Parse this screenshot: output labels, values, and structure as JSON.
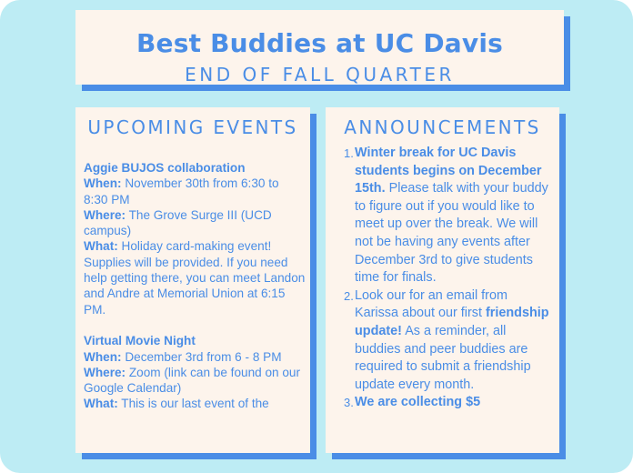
{
  "header": {
    "title": "Best Buddies at UC Davis",
    "subtitle": "END OF FALL QUARTER"
  },
  "events": {
    "heading": "UPCOMING EVENTS",
    "when_label": "When:",
    "where_label": "Where:",
    "what_label": "What:",
    "items": [
      {
        "title": "Aggie BUJOS collaboration",
        "when": "November 30th from 6:30 to 8:30 PM",
        "where": "The Grove Surge III (UCD campus)",
        "what": "Holiday card-making event! Supplies will be provided. If you need help getting there, you can meet Landon and Andre at Memorial Union at 6:15 PM."
      },
      {
        "title": "Virtual Movie Night",
        "when": "December 3rd from 6 - 8 PM",
        "where": "Zoom (link can be found on our Google Calendar)",
        "what": "This is our last event of the"
      }
    ]
  },
  "announcements": {
    "heading": "ANNOUNCEMENTS",
    "items": [
      {
        "num": "1.",
        "bold": "Winter break for UC Davis students begins on December 15th.",
        "text": "Please talk with your buddy to figure out if you would like to meet up over the break. We will not be having any events after December 3rd to give students time for finals."
      },
      {
        "num": "2.",
        "text_before": "Look our for an email from Karissa about our first",
        "bold": "friendship update!",
        "text": "As a reminder, all buddies and peer buddies are required to submit a friendship update every month."
      },
      {
        "num": "3.",
        "bold": "We are collecting $5",
        "text": ""
      }
    ]
  },
  "colors": {
    "background": "#bdecf4",
    "card": "#fdf4ec",
    "accent": "#4a8de6"
  }
}
